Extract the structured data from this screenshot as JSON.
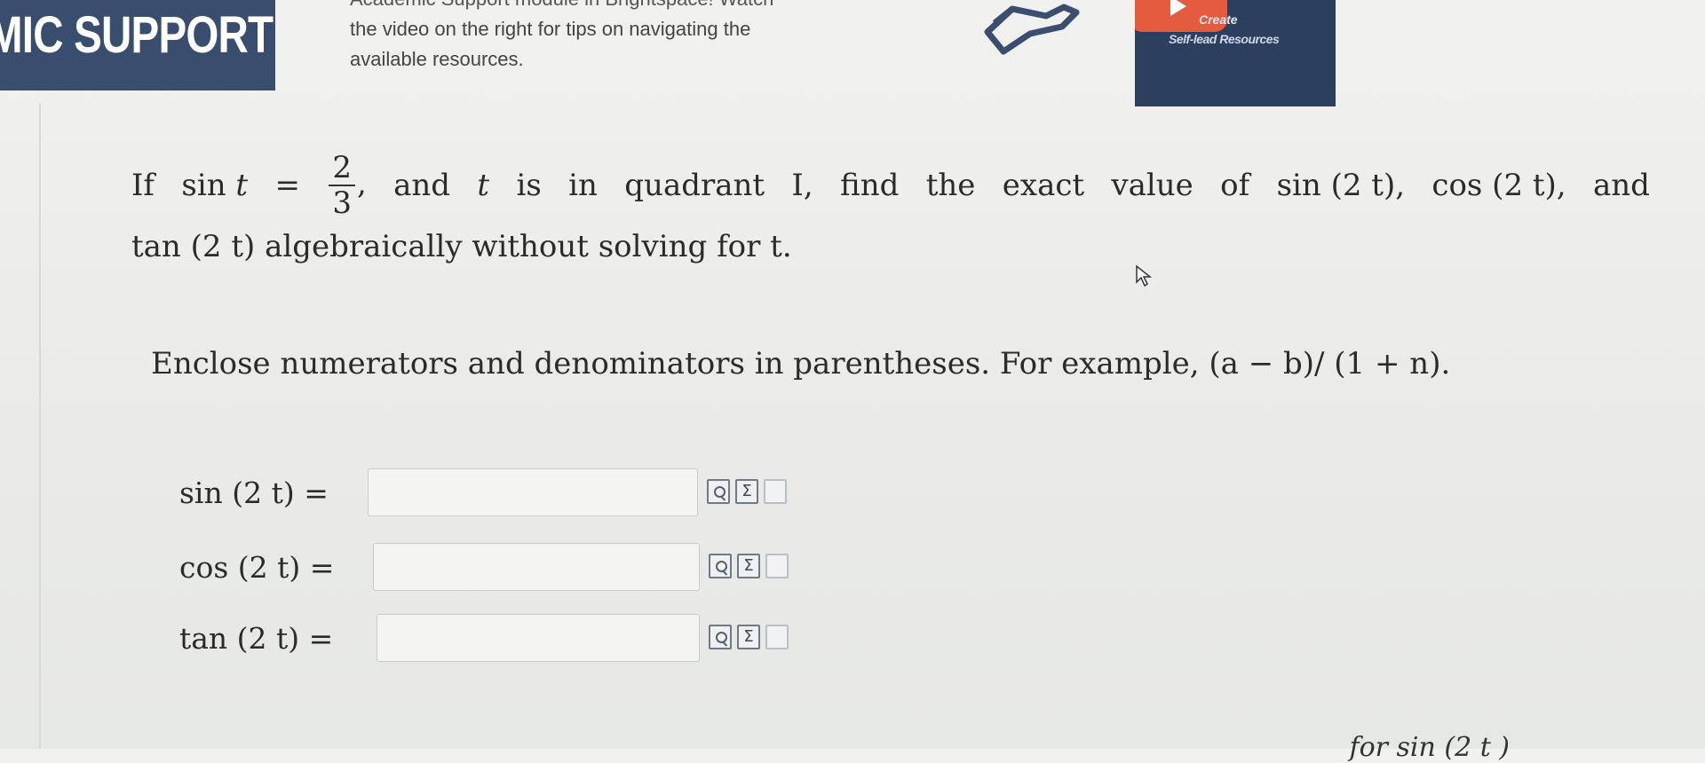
{
  "banner": {
    "title": "MIC SUPPORT"
  },
  "top_text": {
    "line0": "Academic Support module in Brightspace! Watch",
    "line1": "the video on the right for tips on navigating the",
    "line2": "available resources."
  },
  "video": {
    "caption_line1": "Create",
    "caption_line2": "Self-lead Resources"
  },
  "question": {
    "p1": "If",
    "p2": "sin",
    "p3": "t",
    "p4": "=",
    "frac_num": "2",
    "frac_den": "3",
    "p5": ",",
    "p6": "and",
    "p7": "t",
    "p8": "is",
    "p9": "in",
    "p10": "quadrant",
    "p11": "I,",
    "p12": "find",
    "p13": "the",
    "p14": "exact",
    "p15": "value",
    "p16": "of",
    "p17": "sin (2 t),",
    "p18": "cos (2 t),",
    "p19": "and",
    "line2": "tan (2 t) algebraically without solving for t."
  },
  "instruction": "Enclose numerators and denominators in parentheses. For example, (a − b)/ (1 + n).",
  "answers": [
    {
      "label": "sin (2 t) =",
      "value": ""
    },
    {
      "label": "cos (2 t) =",
      "value": ""
    },
    {
      "label": "tan (2 t) =",
      "value": ""
    }
  ],
  "tool_icons": [
    "preview-icon",
    "sigma-icon",
    "blank-page-icon"
  ],
  "bottom_fragment": "for sin (2 t )",
  "colors": {
    "banner": "#394d6e",
    "play_button": "#e55b3d"
  }
}
